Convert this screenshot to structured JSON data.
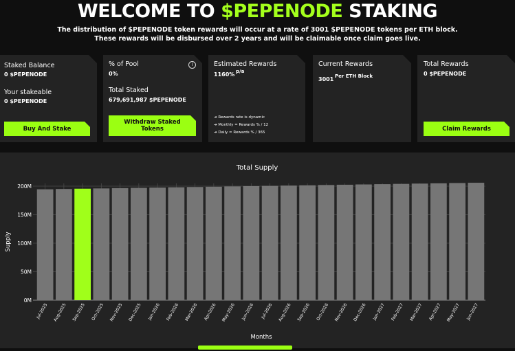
{
  "header": {
    "title_pre": "WELCOME TO ",
    "title_accent": "$PEPENODE",
    "title_post": " STAKING",
    "description": "The distribution of $PEPENODE token rewards will occur at a rate of 3001 $PEPENODE tokens per ETH block. These rewards will be disbursed over 2 years and will be claimable once claim goes live."
  },
  "cards": {
    "balance": {
      "staked_label": "Staked Balance",
      "staked_value": "0 $PEPENODE",
      "stakeable_label": "Your stakeable",
      "stakeable_value": "0 $PEPENODE",
      "button": "Buy And Stake"
    },
    "pool": {
      "pct_label": "% of Pool",
      "pct_value": "0%",
      "total_label": "Total Staked",
      "total_value": "679,691,987 $PEPENODE",
      "button": "Withdraw Staked Tokens",
      "info_icon": "info-icon"
    },
    "estimated": {
      "label": "Estimated Rewards",
      "value": "1160%",
      "suffix": "p/a",
      "notes": [
        "➔ Rewards rate is dynamic",
        "➔ Monthly = Rewards % / 12",
        "➔ Daily = Rewards % / 365"
      ]
    },
    "current": {
      "label": "Current Rewards",
      "value": "3001",
      "suffix": "Per ETH Block"
    },
    "total": {
      "label": "Total Rewards",
      "value": "0 $PEPENODE",
      "button": "Claim Rewards"
    }
  },
  "colors": {
    "accent": "#a4ff1c",
    "button": "#9bff12",
    "bar": "#767676",
    "highlight": "#a0ff1a",
    "panel": "#232323",
    "background": "#0f0f0f"
  },
  "chart_data": {
    "type": "bar",
    "title": "Total Supply",
    "xlabel": "Months",
    "ylabel": "Supply",
    "ylim": [
      0,
      200
    ],
    "yticks": [
      "0M",
      "50M",
      "100M",
      "150M",
      "200M"
    ],
    "ytick_values": [
      0,
      50,
      100,
      150,
      200
    ],
    "grid": true,
    "categories": [
      "Jul-2025",
      "Aug-2025",
      "Sep-2025",
      "Oct-2025",
      "Nov-2025",
      "Dec-2025",
      "Jan-2026",
      "Feb-2026",
      "Mar-2026",
      "Apr-2026",
      "May-2026",
      "Jun-2026",
      "Jul-2026",
      "Aug-2026",
      "Sep-2026",
      "Oct-2026",
      "Nov-2026",
      "Dec-2026",
      "Jan-2027",
      "Feb-2027",
      "Mar-2027",
      "Apr-2027",
      "May-2027",
      "Jun-2027"
    ],
    "values": [
      194.5,
      195,
      195.5,
      196,
      196.5,
      197,
      197.5,
      198,
      198.5,
      199,
      199.5,
      200,
      200.5,
      201,
      201.5,
      202,
      202.5,
      203,
      203.5,
      204,
      204.5,
      205,
      205.5,
      206
    ],
    "highlight_index": 2
  }
}
